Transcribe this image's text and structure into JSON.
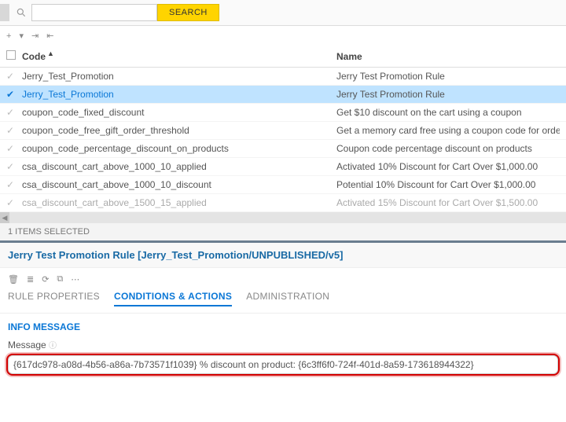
{
  "toolbar": {
    "search_value": "",
    "search_placeholder": "",
    "search_button": "SEARCH"
  },
  "columns": {
    "code": "Code",
    "name": "Name"
  },
  "rows": [
    {
      "selected": false,
      "code": "Jerry_Test_Promotion",
      "name": "Jerry Test Promotion Rule",
      "faded": false
    },
    {
      "selected": true,
      "code": "Jerry_Test_Promotion",
      "name": "Jerry Test Promotion Rule",
      "faded": false
    },
    {
      "selected": false,
      "code": "coupon_code_fixed_discount",
      "name": "Get $10 discount on the cart using a coupon",
      "faded": false
    },
    {
      "selected": false,
      "code": "coupon_code_free_gift_order_threshold",
      "name": "Get a memory card free using a coupon code for orders ove",
      "faded": false
    },
    {
      "selected": false,
      "code": "coupon_code_percentage_discount_on_products",
      "name": "Coupon code percentage discount on products",
      "faded": false
    },
    {
      "selected": false,
      "code": "csa_discount_cart_above_1000_10_applied",
      "name": "Activated 10% Discount for Cart Over $1,000.00",
      "faded": false
    },
    {
      "selected": false,
      "code": "csa_discount_cart_above_1000_10_discount",
      "name": "Potential 10% Discount for Cart Over $1,000.00",
      "faded": false
    },
    {
      "selected": false,
      "code": "csa_discount_cart_above_1500_15_applied",
      "name": "Activated 15% Discount for Cart Over $1,500.00",
      "faded": true
    }
  ],
  "status": "1 ITEMS SELECTED",
  "editor": {
    "title": "Jerry Test Promotion Rule [Jerry_Test_Promotion/UNPUBLISHED/v5]",
    "tabs": {
      "properties": "RULE PROPERTIES",
      "conditions": "CONDITIONS & ACTIONS",
      "admin": "ADMINISTRATION"
    },
    "active_tab": "conditions",
    "section": "INFO MESSAGE",
    "field_label": "Message",
    "message_value": "{617dc978-a08d-4b56-a86a-7b73571f1039} % discount on product: {6c3ff6f0-724f-401d-8a59-173618944322}"
  }
}
